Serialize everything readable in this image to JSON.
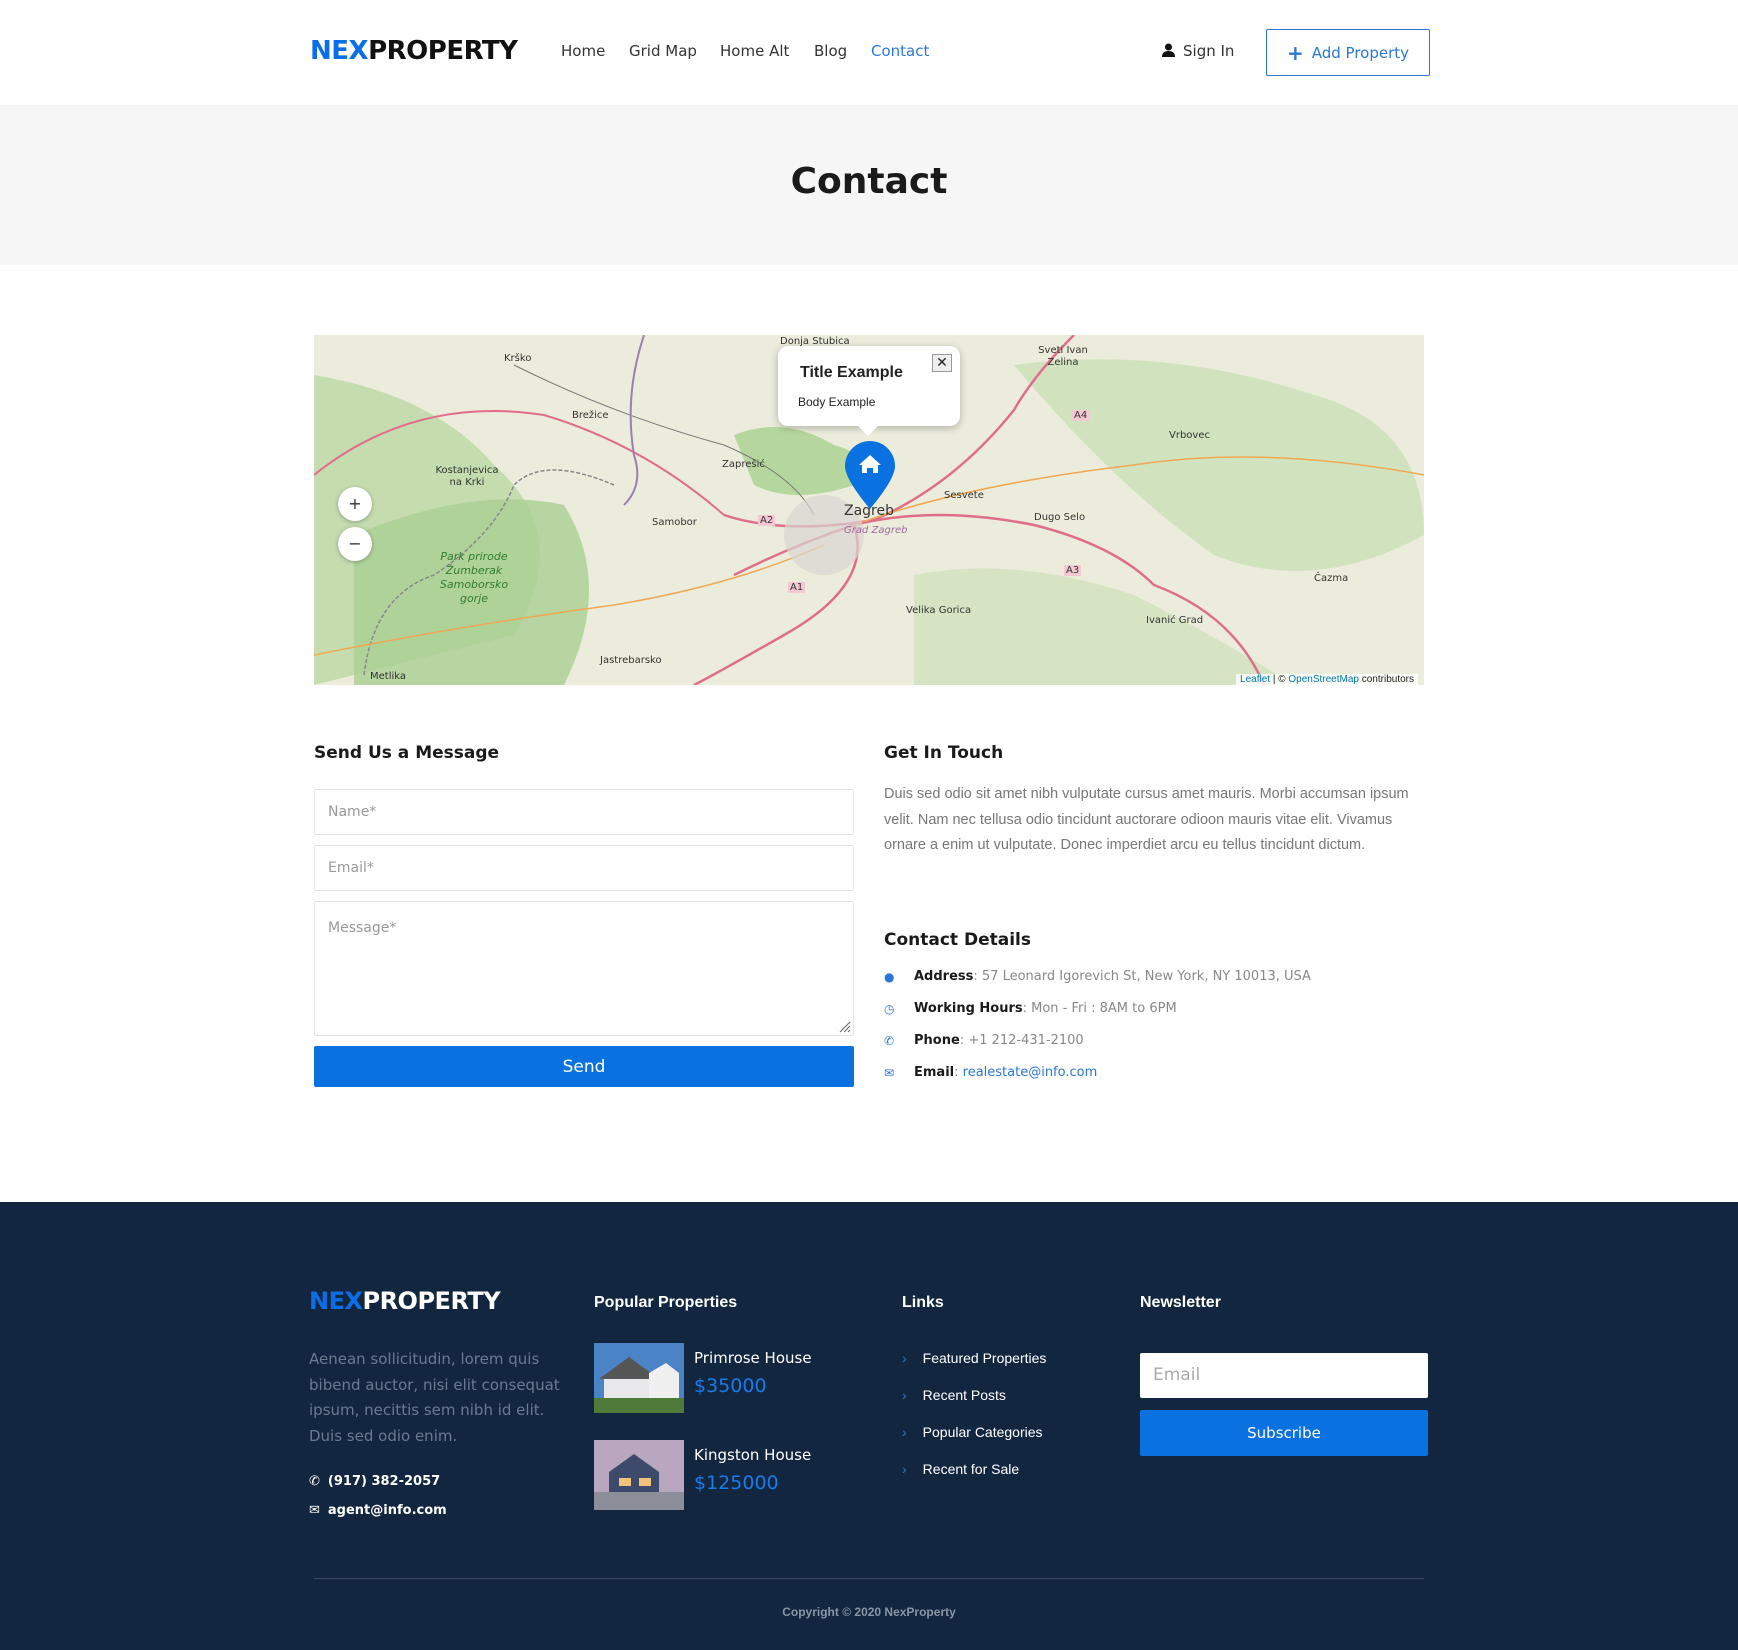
{
  "header": {
    "logo_a": "NEX",
    "logo_b": "PROPERTY",
    "nav": [
      "Home",
      "Grid Map",
      "Home Alt",
      "Blog",
      "Contact"
    ],
    "active": "Contact",
    "sign_in": "Sign In",
    "add_property": "Add Property"
  },
  "hero": {
    "title": "Contact"
  },
  "map": {
    "popup_title": "Title Example",
    "popup_body": "Body Example",
    "zoom_in": "+",
    "zoom_out": "−",
    "attribution_leaflet": "Leaflet",
    "attribution_sep": " | © ",
    "attribution_osm": "OpenStreetMap",
    "attribution_rest": " contributors",
    "labels": [
      "Donja Stubica",
      "Krško",
      "Sveti Ivan Zelina",
      "Brežice",
      "Vrbovec",
      "Kostanjevica na Krki",
      "Zaprešić",
      "Sesvete",
      "Samobor",
      "Zagreb",
      "Grad Zagreb",
      "Dugo Selo",
      "Park prirode Žumberak Samoborsko gorje",
      "Čazma",
      "Velika Gorica",
      "Ivanić Grad",
      "Jastrebarsko",
      "Metlika",
      "A4",
      "A2",
      "A3",
      "A1"
    ]
  },
  "form": {
    "title": "Send Us a Message",
    "name_ph": "Name*",
    "email_ph": "Email*",
    "message_ph": "Message*",
    "send": "Send"
  },
  "touch": {
    "title": "Get In Touch",
    "text": "Duis sed odio sit amet nibh vulputate cursus amet mauris. Morbi accumsan ipsum velit. Nam nec tellusa odio tincidunt auctorare odioon mauris vitae elit. Vivamus ornare a enim ut vulputate. Donec imperdiet arcu eu tellus tincidunt dictum."
  },
  "details": {
    "title": "Contact Details",
    "items": [
      {
        "label": "Address",
        "value": "57 Leonard Igorevich St, New York, NY 10013, USA"
      },
      {
        "label": "Working Hours",
        "value": "Mon - Fri : 8AM to 6PM"
      },
      {
        "label": "Phone",
        "value": "+1 212-431-2100"
      },
      {
        "label": "Email",
        "value": "realestate@info.com"
      }
    ]
  },
  "footer": {
    "logo_a": "NEX",
    "logo_b": "PROPERTY",
    "about": "Aenean sollicitudin, lorem quis bibend auctor, nisi elit consequat ipsum, necittis sem nibh id elit. Duis sed odio enim.",
    "phone": "(917) 382-2057",
    "email": "agent@info.com",
    "popular_title": "Popular Properties",
    "properties": [
      {
        "name": "Primrose House",
        "price": "$35000"
      },
      {
        "name": "Kingston House",
        "price": "$125000"
      }
    ],
    "links_title": "Links",
    "links": [
      "Featured Properties",
      "Recent Posts",
      "Popular Categories",
      "Recent for Sale"
    ],
    "newsletter_title": "Newsletter",
    "newsletter_ph": "Email",
    "subscribe": "Subscribe",
    "copyright": "Copyright © 2020 NexProperty"
  },
  "colors": {
    "accent": "#0a72e0",
    "footer_bg": "#13263f",
    "hero_bg": "#f6f6f6"
  }
}
